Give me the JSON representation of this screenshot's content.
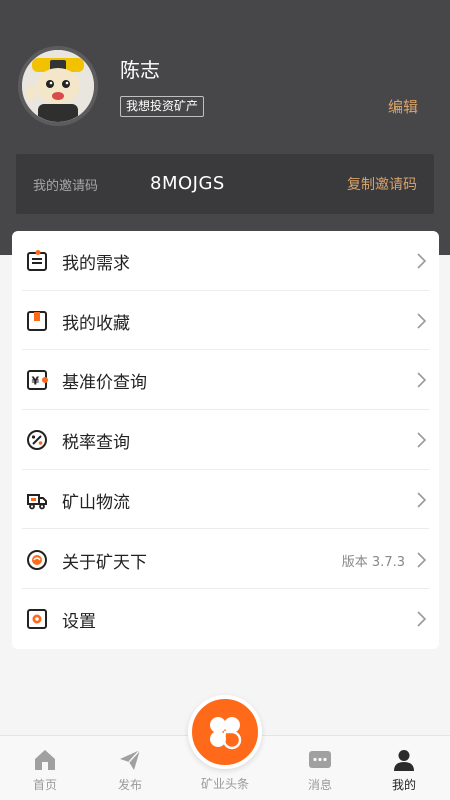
{
  "profile": {
    "name": "陈志",
    "role_tag": "我想投资矿产",
    "edit_label": "编辑"
  },
  "invite": {
    "label": "我的邀请码",
    "code": "8MOJGS",
    "copy_label": "复制邀请码"
  },
  "menu": {
    "items": [
      {
        "label": "我的需求",
        "icon": "clipboard-icon"
      },
      {
        "label": "我的收藏",
        "icon": "bookmark-icon"
      },
      {
        "label": "基准价查询",
        "icon": "price-icon"
      },
      {
        "label": "税率查询",
        "icon": "percent-icon"
      },
      {
        "label": "矿山物流",
        "icon": "truck-icon"
      },
      {
        "label": "关于矿天下",
        "icon": "about-icon",
        "value": "版本 3.7.3"
      },
      {
        "label": "设置",
        "icon": "settings-icon"
      }
    ]
  },
  "tabbar": {
    "home": "首页",
    "publish": "发布",
    "headlines": "矿业头条",
    "messages": "消息",
    "mine": "我的"
  },
  "colors": {
    "header_bg": "#474749",
    "accent_gold": "#d7a36b",
    "accent_orange": "#ff6a1a"
  }
}
